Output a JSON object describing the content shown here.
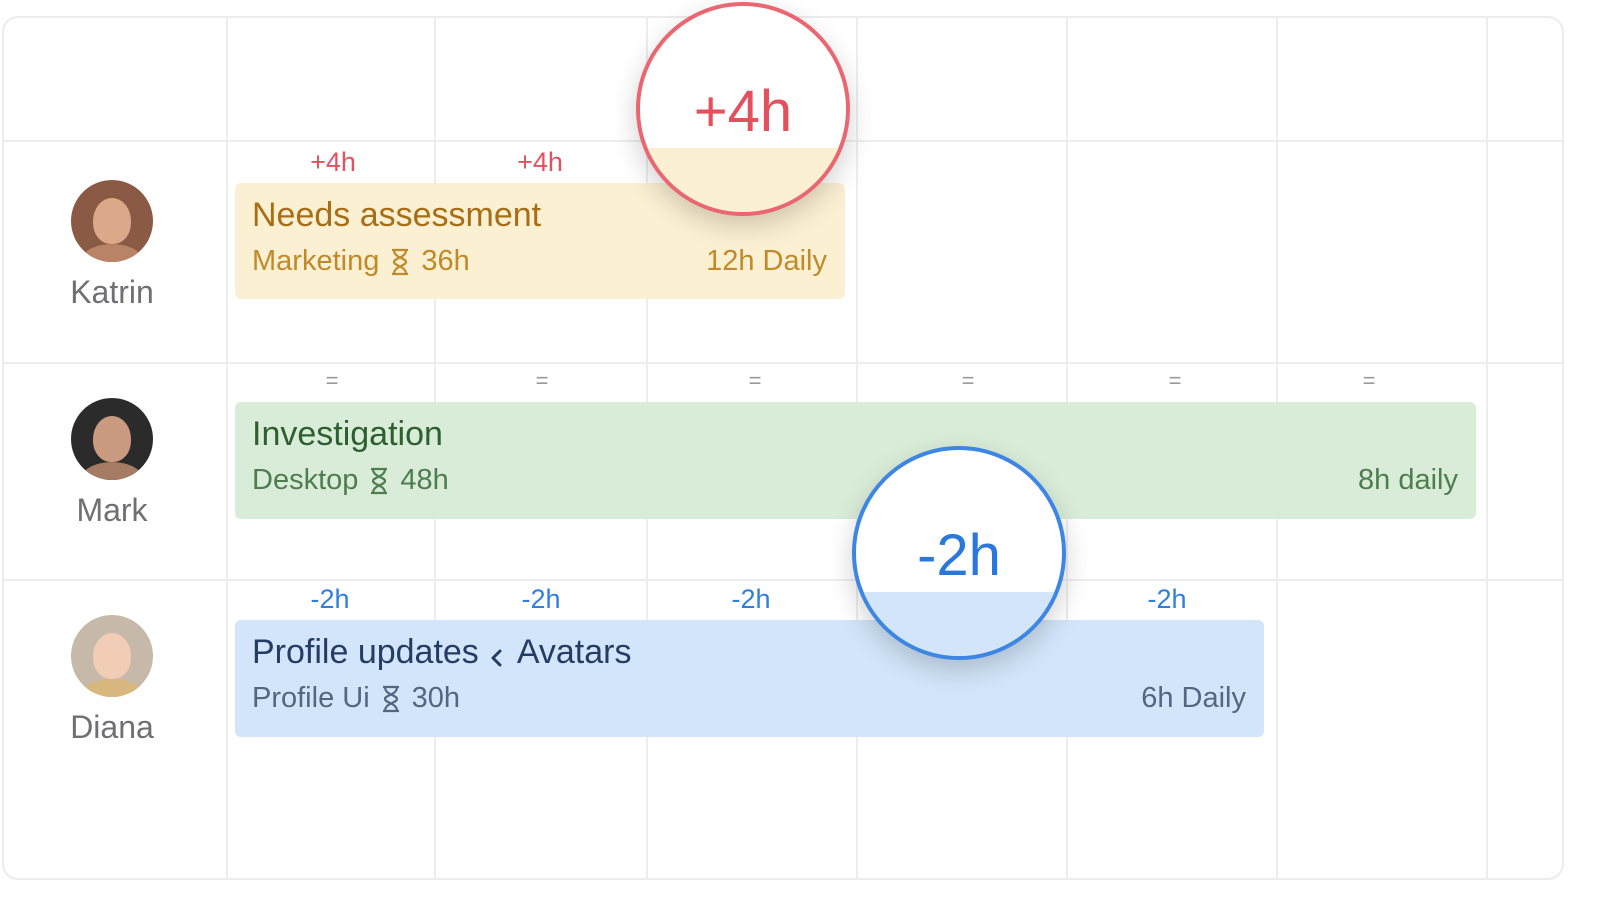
{
  "people": [
    {
      "name": "Katrin"
    },
    {
      "name": "Mark"
    },
    {
      "name": "Diana"
    }
  ],
  "rows": {
    "katrin": {
      "marks": [
        "+4h",
        "+4h"
      ],
      "task": {
        "title": "Needs assessment",
        "project": "Marketing",
        "hours": "36h",
        "daily": "12h Daily"
      },
      "bubble": "+4h"
    },
    "mark": {
      "marks": [
        "=",
        "=",
        "=",
        "=",
        "=",
        "="
      ],
      "task": {
        "title": "Investigation",
        "project": "Desktop",
        "hours": "48h",
        "daily": "8h daily"
      }
    },
    "diana": {
      "marks": [
        "-2h",
        "-2h",
        "-2h",
        "-2h"
      ],
      "task": {
        "title": "Profile updates",
        "subtitle": "Avatars",
        "project": "Profile Ui",
        "hours": "30h",
        "daily": "6h Daily"
      },
      "bubble": "-2h"
    }
  },
  "icons": [
    "hourglass-icon",
    "chevron-left-icon"
  ],
  "colors": {
    "over": "#e0535f",
    "under": "#2f7fe0",
    "yellow_task": "#fcf0d3",
    "green_task": "#d9ecd8",
    "blue_task": "#d2e5fa"
  }
}
